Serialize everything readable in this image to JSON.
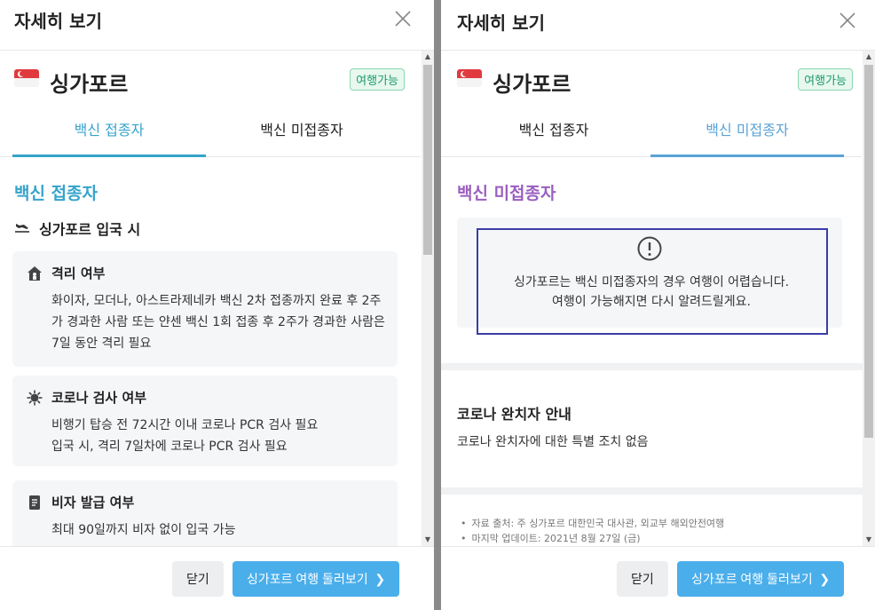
{
  "colors": {
    "accent_blue": "#36a4cc",
    "accent_purple": "#9a5fbf",
    "badge_green": "#1a9b6a",
    "primary_button": "#4aaeeb"
  },
  "panels": [
    {
      "header_title": "자세히 보기",
      "country": "싱가포르",
      "badge": "여행가능",
      "tabs": [
        "백신 접종자",
        "백신 미접종자"
      ],
      "active_tab": 0,
      "section_title": "백신 접종자",
      "entry_title": "싱가포르 입국 시",
      "cards": [
        {
          "icon": "house-icon",
          "title": "격리 여부",
          "body": "화이자, 모더나, 아스트라제네카 백신 2차 접종까지 완료 후 2주가 경과한 사람 또는 얀센 백신 1회 접종 후 2주가 경과한 사람은 7일 동안 격리 필요"
        },
        {
          "icon": "virus-icon",
          "title": "코로나 검사 여부",
          "body_lines": [
            "비행기 탑승 전 72시간 이내 코로나 PCR 검사 필요",
            "입국 시, 격리 7일차에 코로나 PCR 검사 필요"
          ]
        },
        {
          "icon": "document-icon",
          "title": "비자 발급 여부",
          "body": "최대 90일까지 비자 없이 입국 가능"
        }
      ],
      "footer": {
        "close_label": "닫기",
        "primary_label": "싱가포르 여행 둘러보기"
      }
    },
    {
      "header_title": "자세히 보기",
      "country": "싱가포르",
      "badge": "여행가능",
      "tabs": [
        "백신 접종자",
        "백신 미접종자"
      ],
      "active_tab": 1,
      "section_title": "백신 미접종자",
      "notice_lines": [
        "싱가포르는 백신 미접종자의 경우 여행이 어렵습니다.",
        "여행이 가능해지면 다시 알려드릴게요."
      ],
      "covid_title": "코로나 완치자 안내",
      "covid_text": "코로나 완치자에 대한 특별 조치 없음",
      "sources": [
        "자료 출처: 주 싱가포르 대한민국 대사관, 외교부 해외안전여행",
        "마지막 업데이트: 2021년 8월 27일 (금)"
      ],
      "footer": {
        "close_label": "닫기",
        "primary_label": "싱가포르 여행 둘러보기"
      }
    }
  ]
}
